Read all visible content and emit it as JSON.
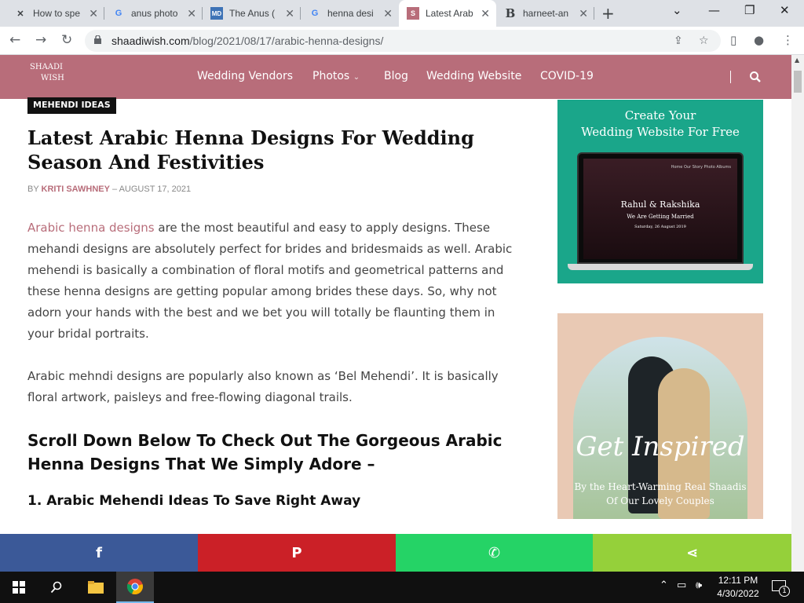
{
  "browser": {
    "tabs": [
      {
        "title": "How to spe",
        "icon": "tools-icon"
      },
      {
        "title": "anus photo",
        "icon": "google-icon"
      },
      {
        "title": "The Anus (",
        "icon": "webmd-icon"
      },
      {
        "title": "henna desi",
        "icon": "google-icon"
      },
      {
        "title": "Latest Arab",
        "icon": "shaadiwish-icon",
        "active": true
      },
      {
        "title": "harneet-an",
        "icon": "b-icon"
      }
    ],
    "url_host": "shaadiwish.com",
    "url_path": "/blog/2021/08/17/arabic-henna-designs/"
  },
  "site": {
    "logo_line1": "SHAADI",
    "logo_line2": "WISH",
    "nav": [
      "Wedding Vendors",
      "Photos",
      "Blog",
      "Wedding Website",
      "COVID-19"
    ],
    "header_color": "#b86d7a"
  },
  "article": {
    "tag": "MEHENDI IDEAS",
    "title": "Latest Arabic Henna Designs For Wedding Season And Festivities",
    "by": "BY",
    "author": "KRITI SAWHNEY",
    "dash": "–",
    "date": "AUGUST 17, 2021",
    "p1_link": "Arabic henna designs",
    "p1_rest": " are the most beautiful and easy to apply designs. These mehandi designs are absolutely perfect for brides and bridesmaids as well. Arabic mehendi is basically a combination of floral motifs and geometrical patterns and these henna designs are getting popular among brides these days. So, why not adorn your hands with the best and we bet you will totally be flaunting them in your bridal portraits.",
    "p2": "Arabic mehndi designs are popularly also known as ‘Bel Mehendi’. It is basically floral artwork, paisleys and free-flowing diagonal trails.",
    "h2": "Scroll Down Below To Check Out The Gorgeous Arabic Henna Designs That We Simply Adore –",
    "h3": "1. Arabic Mehendi Ideas To Save Right Away"
  },
  "sidebar": {
    "ad1_line1": "Create Your",
    "ad1_line2": "Wedding Website For Free",
    "ad1_menu": "Home   Our Story   Photo Albums",
    "ad1_names": "Rahul & Rakshika",
    "ad1_tag": "We Are Getting Married",
    "ad1_date": "Saturday, 26 August 2019",
    "ad2_title": "Get Inspired",
    "ad2_sub1": "By the Heart-Warming Real Shaadis",
    "ad2_sub2": "Of Our Lovely Couples"
  },
  "share": [
    {
      "name": "facebook",
      "glyph": "f",
      "color": "#3b5998"
    },
    {
      "name": "pinterest",
      "glyph": "P",
      "color": "#cb2027"
    },
    {
      "name": "whatsapp",
      "glyph": "✆",
      "color": "#25d366"
    },
    {
      "name": "share",
      "glyph": "⋖",
      "color": "#95d03a"
    }
  ],
  "taskbar": {
    "time": "12:11 PM",
    "date": "4/30/2022",
    "notifications": "1"
  }
}
